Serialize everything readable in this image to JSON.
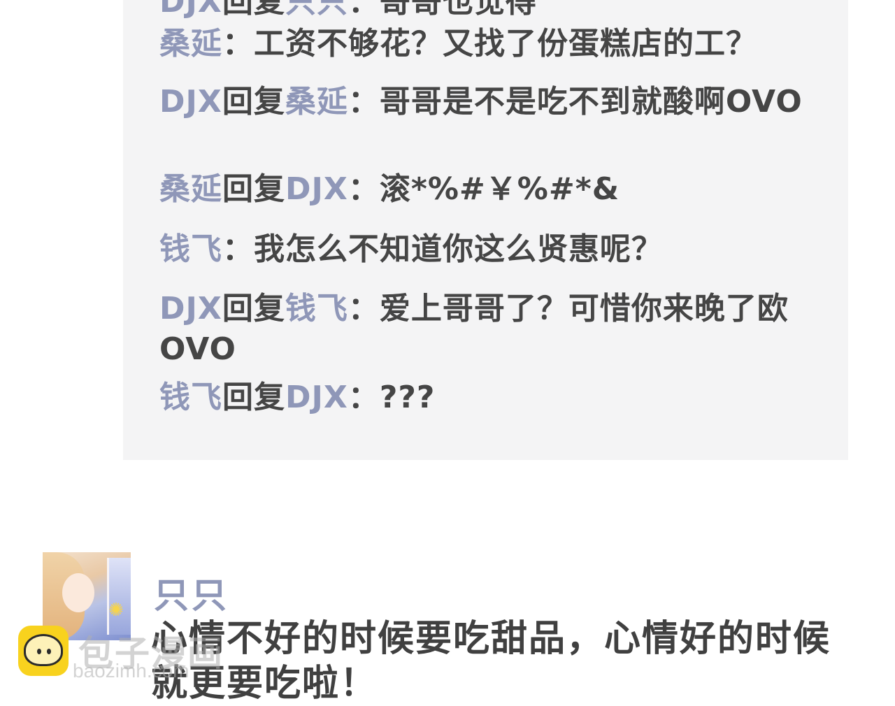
{
  "comments": [
    {
      "name": "DJX",
      "verb": "回复",
      "target": "只只",
      "sep": "：",
      "text": "哥哥也觉得"
    },
    {
      "name": "桑延",
      "verb": "",
      "target": "",
      "sep": "：",
      "text": "工资不够花？又找了份蛋糕店的工？"
    },
    {
      "name": "DJX",
      "verb": "回复",
      "target": "桑延",
      "sep": "：",
      "text": "哥哥是不是吃不到就酸啊OVO"
    },
    {
      "name": "桑延",
      "verb": "回复",
      "target": "DJX",
      "sep": "：",
      "text": "滚*%#￥%#*&"
    },
    {
      "name": "钱飞",
      "verb": "",
      "target": "",
      "sep": "：",
      "text": "我怎么不知道你这么贤惠呢？"
    },
    {
      "name": "DJX",
      "verb": "回复",
      "target": "钱飞",
      "sep": "：",
      "text": "爱上哥哥了？可惜你来晚了欧OVO"
    },
    {
      "name": "钱飞",
      "verb": "回复",
      "target": "DJX",
      "sep": "：",
      "text": "???"
    }
  ],
  "post": {
    "author": "只只",
    "text": "心情不好的时候要吃甜品，心情好的时候就更要吃啦！"
  },
  "watermark": {
    "title": "包子漫画",
    "url": "baozimh.com"
  },
  "colors": {
    "name": "#8f97b8",
    "text": "#454545",
    "panel": "#f4f4f5"
  }
}
